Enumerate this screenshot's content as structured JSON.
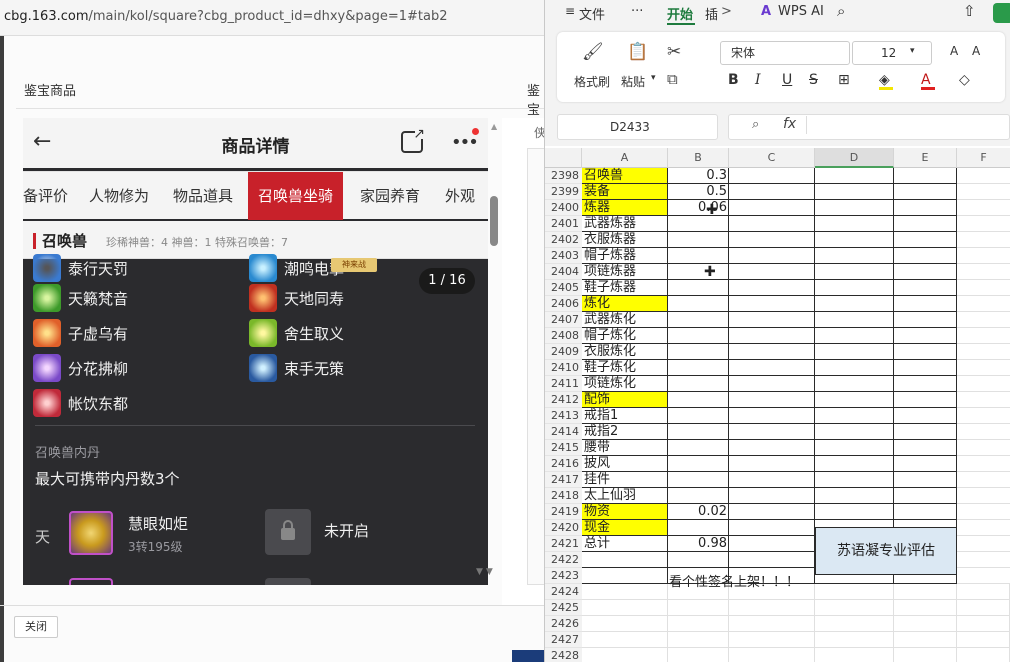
{
  "browser": {
    "url_host": "cbg.163.com",
    "url_path": "/main/kol/square?cbg_product_id=dhxy&page=1#tab2",
    "panel_title": "鉴宝商品",
    "panel_title_clipped": "鉴宝",
    "side_label": "侠",
    "close_button": "关闭"
  },
  "phone": {
    "title": "商品详情",
    "tabs": [
      "备评价",
      "人物修为",
      "物品道具",
      "召唤兽坐骑",
      "家园养育",
      "外观"
    ],
    "active_tab": "召唤兽坐骑",
    "section": {
      "title": "召唤兽",
      "stats": "珍稀神兽：4   神兽：1   特殊召唤兽：7"
    },
    "badge": "神来战",
    "page_indicator": "1 / 16",
    "skills_left": [
      "泰行天罚",
      "天籁梵音",
      "子虚乌有",
      "分花拂柳",
      "帐饮东都"
    ],
    "skills_right": [
      "潮鸣电挚",
      "天地同寿",
      "舍生取义",
      "束手无策"
    ],
    "neidan": {
      "title": "召唤兽内丹",
      "desc": "最大可携带内丹数3个",
      "row_label": "天",
      "item1_name": "慧眼如炬",
      "item1_level": "3转195级",
      "item2_name": "未开启"
    }
  },
  "wps": {
    "menu": {
      "hamburger": "≡",
      "file": "文件",
      "more": "···",
      "start": "开始",
      "insert": "插",
      "ai": "WPS AI"
    },
    "ribbon": {
      "format_painter": "格式刷",
      "paste": "粘贴",
      "font_name": "宋体",
      "font_size": "12",
      "bold": "B",
      "italic": "I",
      "underline": "U",
      "strike": "S"
    },
    "name_box": "D2433",
    "fx": "fx",
    "columns": [
      "A",
      "B",
      "C",
      "D",
      "E",
      "F"
    ],
    "rows": [
      {
        "n": "2398",
        "a": "召唤兽",
        "b": "0.3",
        "hl": true
      },
      {
        "n": "2399",
        "a": "装备",
        "b": "0.5",
        "hl": true
      },
      {
        "n": "2400",
        "a": "炼器",
        "b": "0.06",
        "hl": true
      },
      {
        "n": "2401",
        "a": "武器炼器",
        "b": "",
        "hl": false
      },
      {
        "n": "2402",
        "a": "衣服炼器",
        "b": "",
        "hl": false
      },
      {
        "n": "2403",
        "a": "帽子炼器",
        "b": "",
        "hl": false
      },
      {
        "n": "2404",
        "a": "项链炼器",
        "b": "",
        "hl": false
      },
      {
        "n": "2405",
        "a": "鞋子炼器",
        "b": "",
        "hl": false
      },
      {
        "n": "2406",
        "a": "炼化",
        "b": "",
        "hl": true
      },
      {
        "n": "2407",
        "a": "武器炼化",
        "b": "",
        "hl": false
      },
      {
        "n": "2408",
        "a": "帽子炼化",
        "b": "",
        "hl": false
      },
      {
        "n": "2409",
        "a": "衣服炼化",
        "b": "",
        "hl": false
      },
      {
        "n": "2410",
        "a": "鞋子炼化",
        "b": "",
        "hl": false
      },
      {
        "n": "2411",
        "a": "项链炼化",
        "b": "",
        "hl": false
      },
      {
        "n": "2412",
        "a": "配饰",
        "b": "",
        "hl": true
      },
      {
        "n": "2413",
        "a": "戒指1",
        "b": "",
        "hl": false
      },
      {
        "n": "2414",
        "a": "戒指2",
        "b": "",
        "hl": false
      },
      {
        "n": "2415",
        "a": "腰带",
        "b": "",
        "hl": false
      },
      {
        "n": "2416",
        "a": "披风",
        "b": "",
        "hl": false
      },
      {
        "n": "2417",
        "a": "挂件",
        "b": "",
        "hl": false
      },
      {
        "n": "2418",
        "a": "太上仙羽",
        "b": "",
        "hl": false
      },
      {
        "n": "2419",
        "a": "物资",
        "b": "0.02",
        "hl": true
      },
      {
        "n": "2420",
        "a": "现金",
        "b": "",
        "hl": true
      },
      {
        "n": "2421",
        "a": "总计",
        "b": "0.98",
        "hl": false
      },
      {
        "n": "2422",
        "a": "",
        "b": "",
        "hl": false
      },
      {
        "n": "2423",
        "a": "",
        "b": "",
        "hl": false
      },
      {
        "n": "2424",
        "a": "",
        "b": "",
        "hl": false
      },
      {
        "n": "2425",
        "a": "",
        "b": "",
        "hl": false
      },
      {
        "n": "2426",
        "a": "",
        "b": "",
        "hl": false
      },
      {
        "n": "2427",
        "a": "",
        "b": "",
        "hl": false
      },
      {
        "n": "2428",
        "a": "",
        "b": "",
        "hl": false
      }
    ],
    "merged_note": "苏语凝专业评估",
    "sign_note": "看个性签名上架！！！"
  }
}
